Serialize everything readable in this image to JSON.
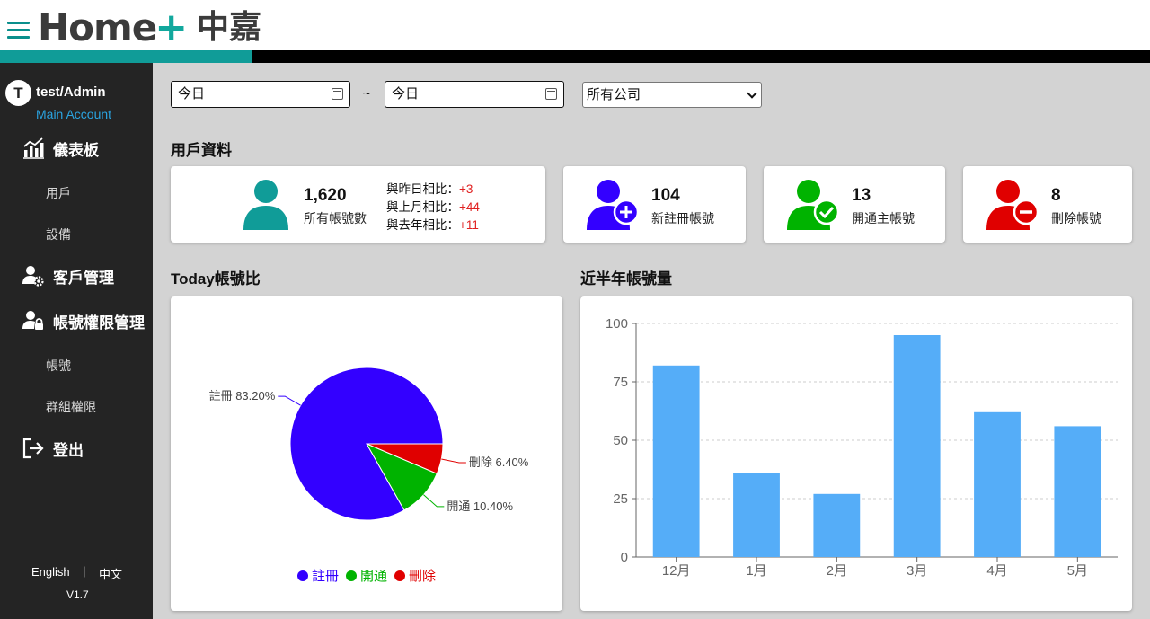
{
  "header": {
    "logo_home": "Home",
    "logo_plus": "+",
    "logo_cn": "中嘉"
  },
  "user": {
    "initial": "T",
    "name": "test/Admin",
    "role": "Main Account"
  },
  "sidebar": {
    "dashboard": "儀表板",
    "dashboard_users": "用戶",
    "dashboard_devices": "設備",
    "customers": "客戶管理",
    "permissions": "帳號權限管理",
    "perm_accounts": "帳號",
    "perm_groups": "群組權限",
    "logout": "登出",
    "lang_en": "English",
    "lang_sep": "|",
    "lang_zh": "中文",
    "version": "V1.7"
  },
  "filters": {
    "start_date": "今日",
    "tilde": "~",
    "end_date": "今日",
    "company": "所有公司"
  },
  "user_section": {
    "title": "用戶資料",
    "total": {
      "value": "1,620",
      "label": "所有帳號數"
    },
    "compare": [
      {
        "label": "與昨日相比：",
        "value": "+3"
      },
      {
        "label": "與上月相比：",
        "value": "+44"
      },
      {
        "label": "與去年相比：",
        "value": "+11"
      }
    ],
    "new_reg": {
      "value": "104",
      "label": "新註冊帳號"
    },
    "activated": {
      "value": "13",
      "label": "開通主帳號"
    },
    "deleted": {
      "value": "8",
      "label": "刪除帳號"
    }
  },
  "colors": {
    "teal": "#109c98",
    "register": "#3300ff",
    "open": "#00b300",
    "delete": "#e00000",
    "bar": "#55adf8"
  },
  "chart_titles": {
    "pie": "Today帳號比",
    "bar": "近半年帳號量"
  },
  "chart_data": [
    {
      "type": "pie",
      "title": "Today帳號比",
      "slices": [
        {
          "name": "註冊",
          "value": 83.2,
          "label": "註冊 83.20%",
          "color": "#3300ff"
        },
        {
          "name": "開通",
          "value": 10.4,
          "label": "開通 10.40%",
          "color": "#00b300"
        },
        {
          "name": "刪除",
          "value": 6.4,
          "label": "刪除 6.40%",
          "color": "#e00000"
        }
      ],
      "legend": "bottom"
    },
    {
      "type": "bar",
      "title": "近半年帳號量",
      "categories": [
        "12月",
        "1月",
        "2月",
        "3月",
        "4月",
        "5月"
      ],
      "values": [
        82,
        36,
        27,
        95,
        62,
        56
      ],
      "ylim": [
        0,
        100
      ],
      "yticks": [
        0,
        25,
        50,
        75,
        100
      ],
      "grid": true,
      "color": "#55adf8"
    }
  ]
}
